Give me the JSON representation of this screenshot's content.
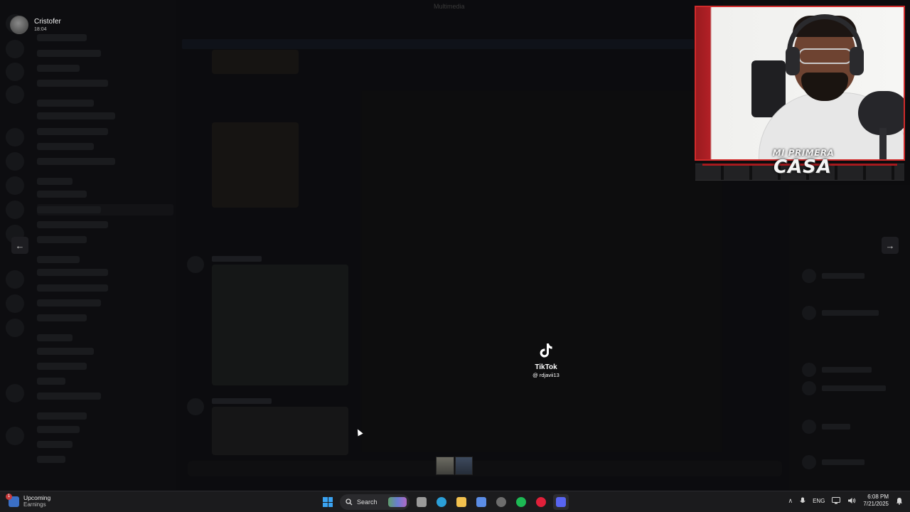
{
  "window": {
    "title": "Multimedia"
  },
  "user": {
    "name": "Cristofer",
    "time": "18:04"
  },
  "navigation": {
    "prev_glyph": "←",
    "next_glyph": "→"
  },
  "tiktok": {
    "brand": "TikTok",
    "handle": "@ rdjavii13"
  },
  "webcam": {
    "overlay_line1": "MI PRIMERA",
    "overlay_line2": "CASA",
    "accent_color": "#d12b2b"
  },
  "taskbar": {
    "news_badge": "1",
    "news_title": "Upcoming",
    "news_subtitle": "Earnings",
    "search_placeholder": "Search",
    "pinned_apps": [
      {
        "name": "task-view-icon",
        "color": "#9a9a9a"
      },
      {
        "name": "edge-icon",
        "color": "#2b9fd8"
      },
      {
        "name": "file-explorer-icon",
        "color": "#f2c14e"
      },
      {
        "name": "copilot-icon",
        "color": "#5b8de6"
      },
      {
        "name": "chrome-icon",
        "color": "#6d6d6d"
      },
      {
        "name": "spotify-icon",
        "color": "#1db954"
      },
      {
        "name": "opera-icon",
        "color": "#e0203a"
      },
      {
        "name": "discord-icon",
        "color": "#5865f2"
      }
    ],
    "tray": {
      "chevron": "∧",
      "language": "ENG",
      "time": "6:08 PM",
      "date": "7/21/2025"
    }
  }
}
